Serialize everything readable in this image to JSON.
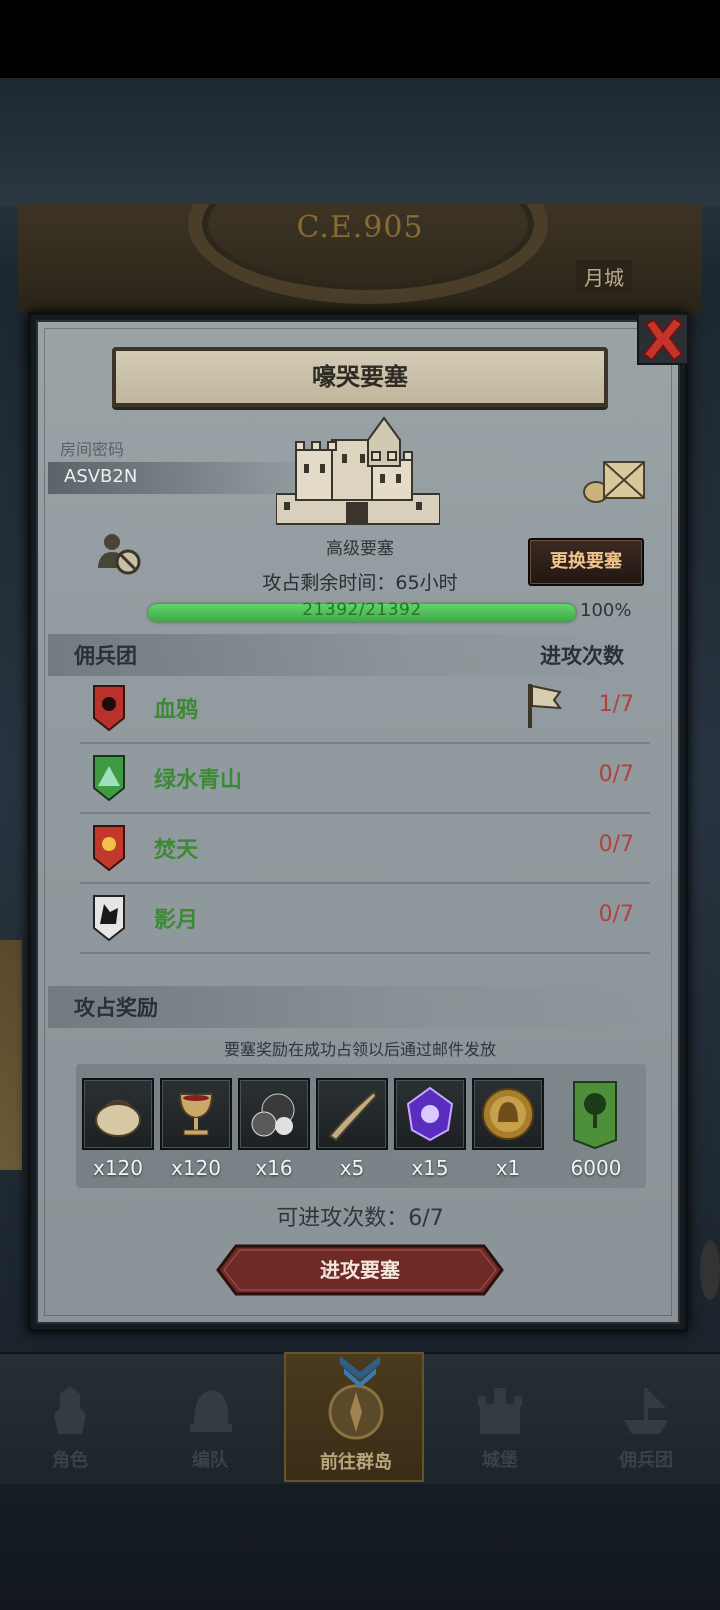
{
  "background": {
    "era": "C.E.905",
    "city_label": "月城"
  },
  "dialog": {
    "title": "嚎哭要塞",
    "room_code_label": "房间密码",
    "room_code": "ASVB2N",
    "fortress_grade": "高级要塞",
    "change_button": "更换要塞",
    "time_left": "攻占剩余时间：65小时",
    "hp_text": "21392/21392",
    "hp_fraction": 1.0,
    "hp_percent": "100%"
  },
  "mercenaries": {
    "header": "佣兵团",
    "count_header": "进攻次数",
    "rows": [
      {
        "name": "血鸦",
        "count": "1/7",
        "shield_color": "#b8312a",
        "flag": true
      },
      {
        "name": "绿水青山",
        "count": "0/7",
        "shield_color": "#3f9b3f",
        "flag": false
      },
      {
        "name": "焚天",
        "count": "0/7",
        "shield_color": "#c0392b",
        "flag": false
      },
      {
        "name": "影月",
        "count": "0/7",
        "shield_color": "#e6e6e6",
        "flag": false
      }
    ]
  },
  "rewards": {
    "header": "攻占奖励",
    "note": "要塞奖励在成功占领以后通过邮件发放",
    "items": [
      {
        "icon": "pouch-icon",
        "qty": "x120"
      },
      {
        "icon": "goblet-icon",
        "qty": "x120"
      },
      {
        "icon": "ore-icon",
        "qty": "x16"
      },
      {
        "icon": "horn-icon",
        "qty": "x5"
      },
      {
        "icon": "purple-crystal-icon",
        "qty": "x15"
      },
      {
        "icon": "helmet-medal-icon",
        "qty": "x1"
      },
      {
        "icon": "tree-banner-icon",
        "qty": "6000"
      }
    ]
  },
  "remaining_attacks": "可进攻次数：6/7",
  "attack_button": "进攻要塞",
  "bottom_nav": [
    {
      "label": "角色",
      "active": false
    },
    {
      "label": "编队",
      "active": false
    },
    {
      "label": "前往群岛",
      "active": true
    },
    {
      "label": "城堡",
      "active": false
    },
    {
      "label": "佣兵团",
      "active": false
    }
  ],
  "colors": {
    "hp_green": "#3ea848",
    "count_red": "#b2413d",
    "merc_green": "#3c8a35"
  }
}
